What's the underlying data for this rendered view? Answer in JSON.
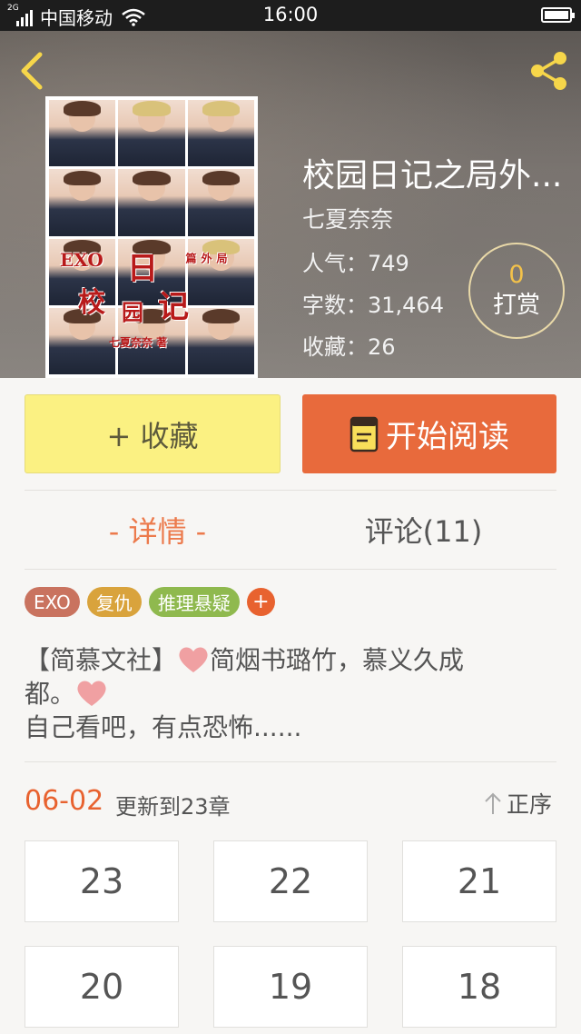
{
  "status_bar": {
    "network_type": "2G",
    "carrier": "中国移动",
    "time": "16:00"
  },
  "book": {
    "title": "校园日记之局外...",
    "author": "七夏奈奈",
    "stats": {
      "popularity_label": "人气：749",
      "word_count_label": "字数：31,464",
      "favorites_label": "收藏：26"
    },
    "tip": {
      "count": "0",
      "label": "打赏"
    },
    "cover": {
      "text_exo": "EXO",
      "text_c1": "日",
      "text_c2": "校",
      "text_c3": "园",
      "text_c4": "记",
      "text_side": "局外篇",
      "author_line": "七夏奈奈 著"
    }
  },
  "actions": {
    "favorite_label": "+ 收藏",
    "read_label": "开始阅读"
  },
  "tabs": {
    "detail_label": "- 详情 -",
    "comments_label": "评论(11)"
  },
  "tags": [
    {
      "label": "EXO",
      "color": "#c9735f"
    },
    {
      "label": "复仇",
      "color": "#d9a33c"
    },
    {
      "label": "推理悬疑",
      "color": "#8fb94e"
    }
  ],
  "tag_add_label": "+",
  "description": {
    "line1_prefix": "【简慕文社】",
    "line1_suffix": "简烟书璐竹，慕义久成",
    "line2": "都。",
    "line3": "自己看吧，有点恐怖......"
  },
  "update": {
    "date": "06-02",
    "text": "更新到23章",
    "sort_label": "正序"
  },
  "chapters": [
    "23",
    "22",
    "21",
    "20",
    "19",
    "18"
  ],
  "colors": {
    "accent": "#e8622f",
    "tab_active": "#ec7a4c",
    "favorite_bg": "#fbf182",
    "read_bg": "#e86a3c",
    "tip_count": "#f3c24a"
  }
}
